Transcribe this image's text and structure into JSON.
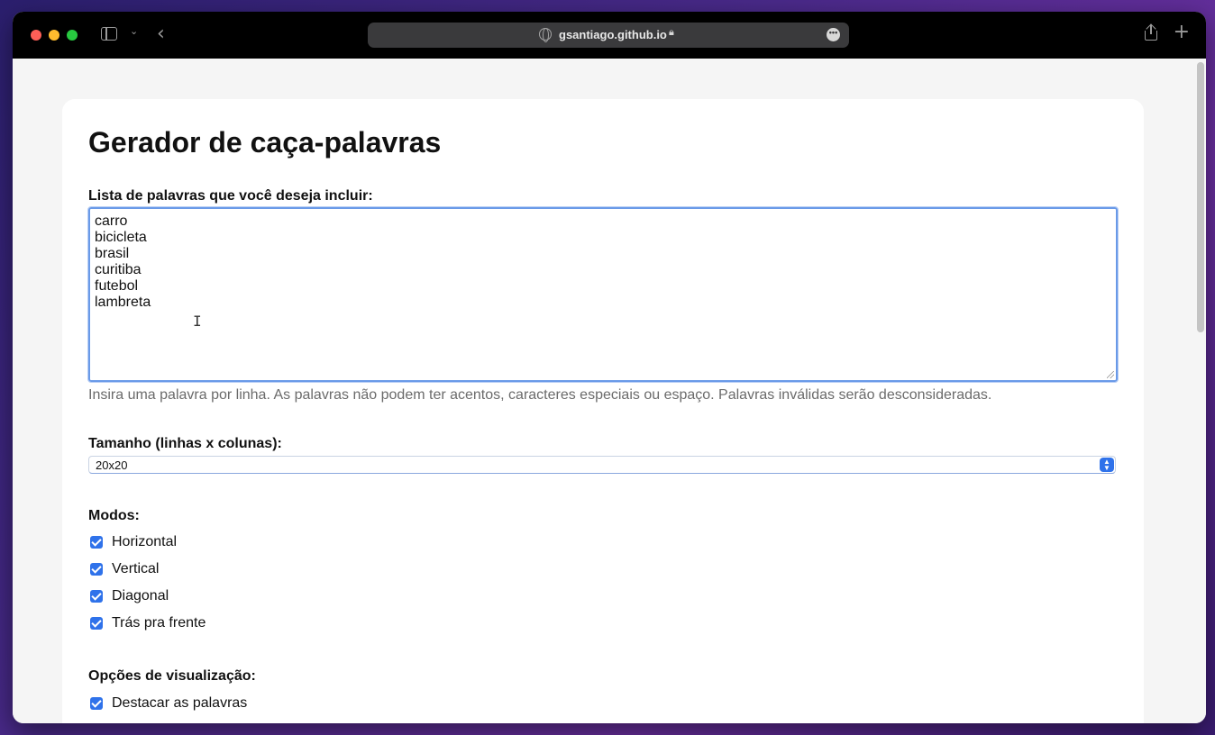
{
  "browser": {
    "url": "gsantiago.github.io",
    "url_more_icon": "ellipsis-circle-icon"
  },
  "page": {
    "title": "Gerador de caça-palavras",
    "words_label": "Lista de palavras que você deseja incluir:",
    "words": [
      "carro",
      "bicicleta",
      "brasil",
      "curitiba",
      "futebol",
      "lambreta"
    ],
    "words_hint": "Insira uma palavra por linha. As palavras não podem ter acentos, caracteres especiais ou espaço. Palavras inválidas serão desconsideradas.",
    "size_label": "Tamanho (linhas x colunas):",
    "size_value": "20x20",
    "modes_label": "Modos:",
    "modes": [
      {
        "label": "Horizontal",
        "checked": true
      },
      {
        "label": "Vertical",
        "checked": true
      },
      {
        "label": "Diagonal",
        "checked": true
      },
      {
        "label": "Trás pra frente",
        "checked": true
      }
    ],
    "view_label": "Opções de visualização:",
    "view_options": [
      {
        "label": "Destacar as palavras",
        "checked": true
      }
    ]
  },
  "colors": {
    "accent": "#2f72ea",
    "focus_border": "#6a9ae8"
  }
}
